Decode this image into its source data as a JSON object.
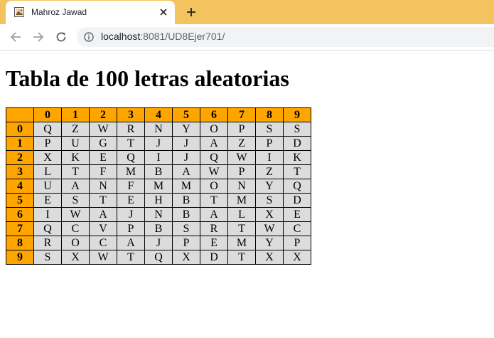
{
  "browser": {
    "tab_title": "Mahroz Jawad",
    "url_host": "localhost",
    "url_rest": ":8081/UD8Ejer701/",
    "favicon": "image-icon",
    "colors": {
      "tabstrip": "#f2c35f",
      "omnibox": "#f1f3f4"
    }
  },
  "page": {
    "title": "Tabla de 100 letras aleatorias",
    "table": {
      "corner": "",
      "columns": [
        "0",
        "1",
        "2",
        "3",
        "4",
        "5",
        "6",
        "7",
        "8",
        "9"
      ],
      "rows": [
        {
          "label": "0",
          "cells": [
            "Q",
            "Z",
            "W",
            "R",
            "N",
            "Y",
            "O",
            "P",
            "S",
            "S"
          ]
        },
        {
          "label": "1",
          "cells": [
            "P",
            "U",
            "G",
            "T",
            "J",
            "J",
            "A",
            "Z",
            "P",
            "D"
          ]
        },
        {
          "label": "2",
          "cells": [
            "X",
            "K",
            "E",
            "Q",
            "I",
            "J",
            "Q",
            "W",
            "I",
            "K"
          ]
        },
        {
          "label": "3",
          "cells": [
            "L",
            "T",
            "F",
            "M",
            "B",
            "A",
            "W",
            "P",
            "Z",
            "T"
          ]
        },
        {
          "label": "4",
          "cells": [
            "U",
            "A",
            "N",
            "F",
            "M",
            "M",
            "O",
            "N",
            "Y",
            "Q"
          ]
        },
        {
          "label": "5",
          "cells": [
            "E",
            "S",
            "T",
            "E",
            "H",
            "B",
            "T",
            "M",
            "S",
            "D"
          ]
        },
        {
          "label": "6",
          "cells": [
            "I",
            "W",
            "A",
            "J",
            "N",
            "B",
            "A",
            "L",
            "X",
            "E"
          ]
        },
        {
          "label": "7",
          "cells": [
            "Q",
            "C",
            "V",
            "P",
            "B",
            "S",
            "R",
            "T",
            "W",
            "C"
          ]
        },
        {
          "label": "8",
          "cells": [
            "R",
            "O",
            "C",
            "A",
            "J",
            "P",
            "E",
            "M",
            "Y",
            "P"
          ]
        },
        {
          "label": "9",
          "cells": [
            "S",
            "X",
            "W",
            "T",
            "Q",
            "X",
            "D",
            "T",
            "X",
            "X"
          ]
        }
      ],
      "colors": {
        "header": "#ffa500",
        "cell": "#dcdcdc",
        "border": "#000000"
      }
    }
  }
}
